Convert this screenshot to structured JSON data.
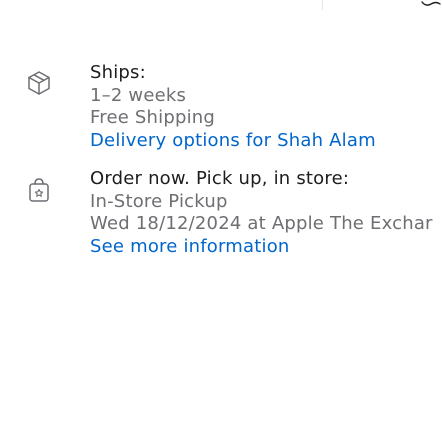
{
  "shipping": {
    "icon": "box-icon",
    "label": "Ships:",
    "timeframe": "1–2 weeks",
    "cost": "Free Shipping",
    "delivery_link": "Delivery options for Shah Alam"
  },
  "pickup": {
    "icon": "shopping-bag-icon",
    "label": "Order now. Pick up, in store:",
    "method": "In-Store Pickup",
    "date_location": "Wed 18/12/2024 at Apple The Exchar",
    "more_link": "See more information"
  },
  "colors": {
    "text": "#1d1d1f",
    "secondary": "#6e6e73",
    "link": "#0066cc",
    "icon": "#6e6e73"
  }
}
